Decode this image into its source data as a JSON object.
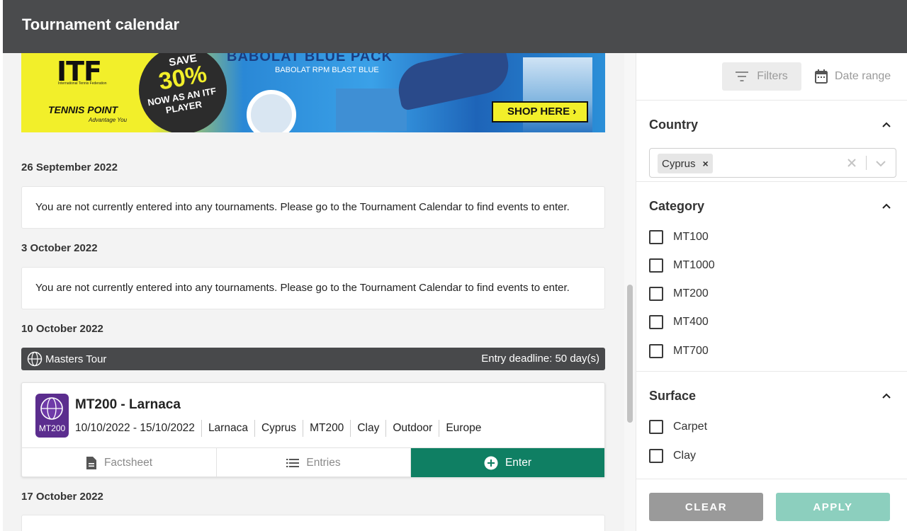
{
  "app": {
    "title": "Tournament calendar"
  },
  "banner": {
    "itf": "ITF",
    "itf_sub": "International Tennis Federation",
    "tennis_point": "TENNIS POINT",
    "tennis_point_sub": "Advantage You",
    "save_line1": "SAVE",
    "save_line2": "30%",
    "save_line3": "NOW AS AN ITF PLAYER",
    "pack_title": "BABOLAT BLUE PACK",
    "pack_sub": "BABOLAT RPM BLAST BLUE",
    "shop_cta": "SHOP HERE ›"
  },
  "sections": [
    {
      "date": "26 September 2022",
      "notice": "You are not currently entered into any tournaments. Please go to the Tournament Calendar to find events to enter."
    },
    {
      "date": "3 October 2022",
      "notice": "You are not currently entered into any tournaments. Please go to the Tournament Calendar to find events to enter."
    },
    {
      "date": "10 October 2022"
    },
    {
      "date": "17 October 2022"
    }
  ],
  "tour": {
    "name": "Masters Tour",
    "deadline": "Entry deadline: 50 day(s)"
  },
  "event": {
    "badge": "MT200",
    "title": "MT200 - Larnaca",
    "meta": [
      "10/10/2022 - 15/10/2022",
      "Larnaca",
      "Cyprus",
      "MT200",
      "Clay",
      "Outdoor",
      "Europe"
    ],
    "actions": {
      "factsheet": "Factsheet",
      "entries": "Entries",
      "enter": "Enter"
    }
  },
  "filters": {
    "tab_filters": "Filters",
    "tab_date": "Date range",
    "country": {
      "label": "Country",
      "selected": "Cyprus"
    },
    "category": {
      "label": "Category",
      "options": [
        "MT100",
        "MT1000",
        "MT200",
        "MT400",
        "MT700"
      ]
    },
    "surface": {
      "label": "Surface",
      "options": [
        "Carpet",
        "Clay"
      ]
    },
    "clear": "CLEAR",
    "apply": "APPLY"
  },
  "colors": {
    "header": "#4a4b4d",
    "enter": "#0f7f63",
    "apply": "#8ccfbe",
    "clear": "#9a9a9a",
    "badge": "#5b2d8e"
  }
}
